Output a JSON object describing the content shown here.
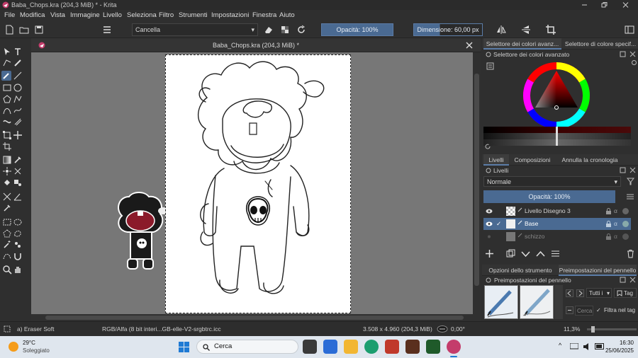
{
  "title_bar": {
    "title": "Baba_Chops.kra (204,3 MiB) * - Krita"
  },
  "menu": [
    "File",
    "Modifica",
    "Vista",
    "Immagine",
    "Livello",
    "Seleziona",
    "Filtro",
    "Strumenti",
    "Impostazioni",
    "Finestra",
    "Aiuto"
  ],
  "toolbar": {
    "brush_preset": "Cancella",
    "opacity": "Opacità: 100%",
    "size": "Dimensione: 60,00 px"
  },
  "document": {
    "tab_title": "Baba_Chops.kra (204,3 MiB) *"
  },
  "dockers": {
    "top_tabs": [
      "Selettore dei colori avanz...",
      "Selettore di colore specif..."
    ],
    "color_selector_title": "Selettore dei colori avanzato",
    "mid_tabs": [
      "Livelli",
      "Composizioni",
      "Annulla la cronologia"
    ],
    "layers_title": "Livelli",
    "blend_mode": "Normale",
    "layer_opacity": "Opacità:  100%",
    "layers": [
      {
        "name": "Livello Disegno 3",
        "selected": false
      },
      {
        "name": "Base",
        "selected": true
      },
      {
        "name": "schizzo",
        "selected": false
      }
    ],
    "bottom_tabs": [
      "Opzioni dello strumento",
      "Preimpostazioni del pennello"
    ],
    "presets_title": "Preimpostazioni del pennello",
    "tag_filter": "Tutti i",
    "tag_button": "Tag",
    "search_placeholder": "Cerca",
    "filter_in_tag": "Filtra nel tag"
  },
  "status": {
    "brush": "a) Eraser Soft",
    "color_model": "RGB/Alfa (8 bit interi...GB-elle-V2-srgbtrc.icc",
    "dimensions": "3.508 x 4.960 (204,3 MiB)",
    "rotation": "0,00°",
    "zoom": "11,3%"
  },
  "taskbar": {
    "temperature": "29°C",
    "weather": "Soleggiato",
    "search": "Cerca",
    "time": "16:30",
    "date": "25/06/2025"
  },
  "colors": {
    "accent": "#4a6a92",
    "foreground": "#000000",
    "background": "#ffffff"
  }
}
